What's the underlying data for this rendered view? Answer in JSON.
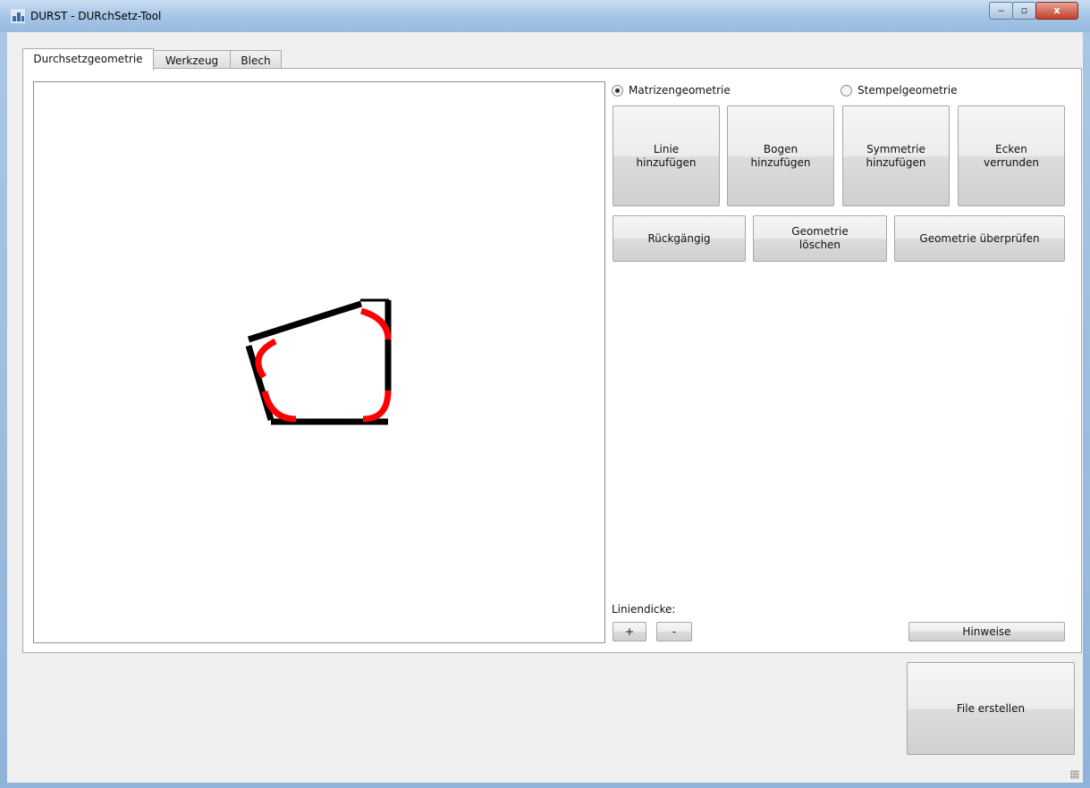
{
  "window": {
    "title": "DURST - DURchSetz-Tool",
    "min_label": "‒",
    "max_label": "▫",
    "close_label": "x"
  },
  "tabs": [
    {
      "label": "Durchsetzgeometrie"
    },
    {
      "label": "Werkzeug"
    },
    {
      "label": "Blech"
    }
  ],
  "geometry_mode": {
    "options": [
      {
        "label": "Matrizengeometrie",
        "selected": true
      },
      {
        "label": "Stempelgeometrie",
        "selected": false
      }
    ]
  },
  "tools": [
    {
      "label": "Linie\nhinzufügen"
    },
    {
      "label": "Bogen\nhinzufügen"
    },
    {
      "label": "Symmetrie\nhinzufügen"
    },
    {
      "label": "Ecken\nverrunden"
    }
  ],
  "actions": {
    "undo": "Rückgängig",
    "delete": "Geometrie\nlöschen",
    "check": "Geometrie überprüfen"
  },
  "line_width": {
    "label": "Liniendicke:",
    "plus": "+",
    "minus": "-"
  },
  "hints_label": "Hinweise",
  "create_file_label": "File erstellen",
  "colors": {
    "line": "#000000",
    "arc": "#ff0000"
  }
}
